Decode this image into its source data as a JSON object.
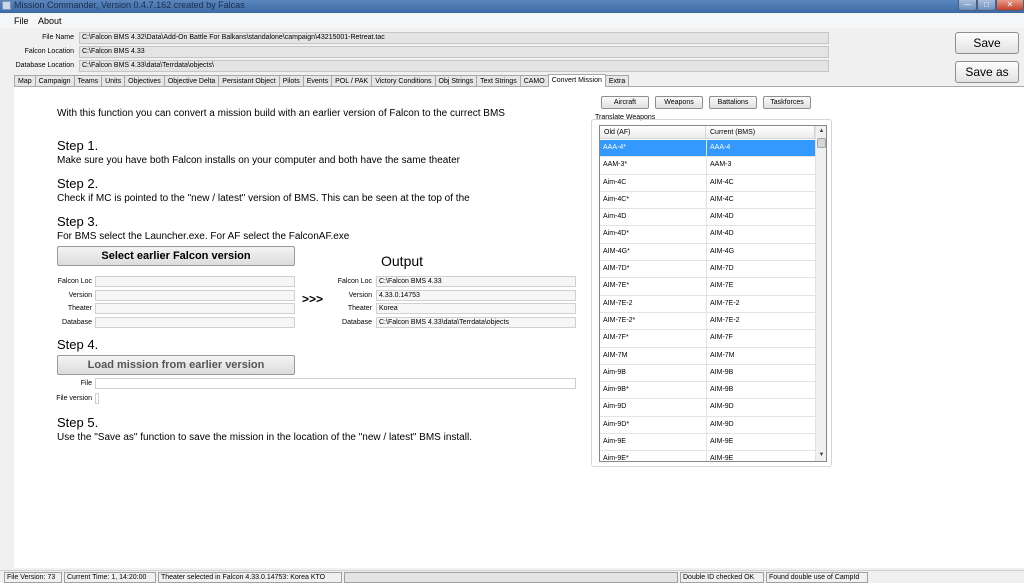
{
  "window": {
    "title": "Mission Commander, Version 0.4.7.162 created by Falcas"
  },
  "menu": [
    "File",
    "About"
  ],
  "header": {
    "file_name_label": "File Name",
    "file_name": "C:\\Falcon BMS 4.32\\Data\\Add-On Battle For Balkans\\standalone\\campaign\\43215001-Retreat.tac",
    "falcon_location_label": "Falcon Location",
    "falcon_location": "C:\\Falcon BMS 4.33",
    "database_location_label": "Database Location",
    "database_location": "C:\\Falcon BMS 4.33\\data\\Terrdata\\objects\\",
    "save_label": "Save",
    "save_as_label": "Save as"
  },
  "tabs": [
    "Map",
    "Campaign",
    "Teams",
    "Units",
    "Objectives",
    "Objective Delta",
    "Persistant Object",
    "Pilots",
    "Events",
    "POL / PAK",
    "Victory Conditions",
    "Obj Strings",
    "Text Strings",
    "CAMO",
    "Convert Mission",
    "Extra"
  ],
  "active_tab": "Convert Mission",
  "convert": {
    "intro": "With this function you can convert a mission build with an earlier version of Falcon to the currect BMS",
    "step1_title": "Step 1.",
    "step1_text": "Make sure you have both Falcon installs on your computer and both have the same theater",
    "step2_title": "Step 2.",
    "step2_text": "Check if MC is pointed to the \"new / latest\" version of BMS. This can be seen at the top of the",
    "step3_title": "Step 3.",
    "step3_text": "For BMS select the Launcher.exe. For AF select the FalconAF.exe",
    "select_button": "Select earlier Falcon version",
    "output_title": "Output",
    "arrow": ">>>",
    "input_labels": {
      "loc": "Falcon Loc",
      "version": "Version",
      "theater": "Theater",
      "database": "Database"
    },
    "output": {
      "loc_label": "Falcon Loc",
      "loc": "C:\\Falcon BMS 4.33",
      "version_label": "Version",
      "version": "4.33.0.14753",
      "theater_label": "Theater",
      "theater": "Korea",
      "database_label": "Database",
      "database": "C:\\Falcon BMS 4.33\\data\\Terrdata\\objects"
    },
    "step4_title": "Step 4.",
    "load_button": "Load mission from earlier version",
    "file_label": "File",
    "file_version_label": "File version",
    "step5_title": "Step 5.",
    "step5_text": "Use the \"Save as\" function to save the mission in the location of the \"new / latest\" BMS install."
  },
  "right_panel": {
    "buttons": [
      "Aircraft",
      "Weapons",
      "Battalions",
      "Taskforces"
    ],
    "group_label": "Translate Weapons",
    "col_old": "Old (AF)",
    "col_current": "Current (BMS)",
    "rows": [
      [
        "AAA-4*",
        "AAA-4"
      ],
      [
        "AAM-3*",
        "AAM-3"
      ],
      [
        "Aim-4C",
        "AIM-4C"
      ],
      [
        "Aim-4C*",
        "AIM-4C"
      ],
      [
        "Aim-4D",
        "AIM-4D"
      ],
      [
        "Aim-4D*",
        "AIM-4D"
      ],
      [
        "AIM-4G*",
        "AIM-4G"
      ],
      [
        "AIM-7D*",
        "AIM-7D"
      ],
      [
        "AIM-7E*",
        "AIM-7E"
      ],
      [
        "AIM-7E-2",
        "AIM-7E-2"
      ],
      [
        "AIM-7E-2*",
        "AIM-7E-2"
      ],
      [
        "AIM-7F*",
        "AIM-7F"
      ],
      [
        "AIM-7M",
        "AIM-7M"
      ],
      [
        "Aim-9B",
        "AIM-9B"
      ],
      [
        "Aim-9B*",
        "AIM-9B"
      ],
      [
        "Aim-9D",
        "AIM-9D"
      ],
      [
        "Aim-9D*",
        "AIM-9D"
      ],
      [
        "Aim-9E",
        "AIM-9E"
      ],
      [
        "Aim-9E*",
        "AIM-9E"
      ]
    ],
    "selected_index": 0
  },
  "status": {
    "file_version": "File Version: 73",
    "current_time": "Current Time: 1, 14:20:00",
    "theater": "Theater selected in Falcon 4.33.0.14753: Korea KTO",
    "double_id": "Double ID checked OK",
    "camp_id": "Found double use of CampId"
  },
  "colors": {
    "selection": "#3399ff",
    "titlebar": "#4a76b0"
  }
}
